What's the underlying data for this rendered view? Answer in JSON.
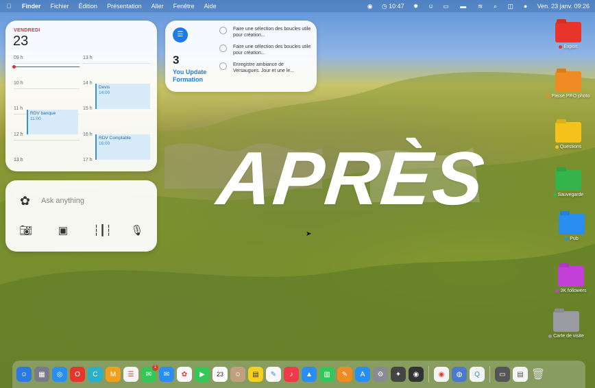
{
  "menubar": {
    "app_name": "Finder",
    "menus": [
      "Fichier",
      "Édition",
      "Présentation",
      "Aller",
      "Fenêtre",
      "Aide"
    ],
    "timer": "10:47",
    "datetime": "Ven. 23 janv. 09:26"
  },
  "calendar": {
    "day_name": "VENDREDI",
    "day_number": "23",
    "hours_left": [
      "09 h",
      "10 h",
      "11 h",
      "12 h",
      "13 h"
    ],
    "hours_right": [
      "13 h",
      "14 h",
      "15 h",
      "16 h",
      "17 h"
    ],
    "events": [
      {
        "title": "RDV banque",
        "time": "11:00"
      },
      {
        "title": "Devis",
        "time": "14:00"
      },
      {
        "title": "RDV Comptable",
        "time": "16:00"
      }
    ]
  },
  "reminders": {
    "count": "3",
    "list_name": "You Update Formation",
    "items": [
      "Faire une sélection des boucles utile pour création...",
      "Faire une sélection des boucles utile pour création...",
      "Enregistre ambiance de Versaugues. Jour et une le..."
    ]
  },
  "chatgpt": {
    "placeholder": "Ask anything",
    "tools": [
      "camera-icon",
      "photo-icon",
      "voice-waveform-icon",
      "microphone-icon"
    ]
  },
  "wallpaper_text": "APRÈS",
  "desktop_items": [
    {
      "label": "Export",
      "color": "#e8352b",
      "tag": "#e8352b"
    },
    {
      "label": "Passe PRO photo",
      "color": "#f08a24",
      "tag": "#f08a24"
    },
    {
      "label": "Questions",
      "color": "#f5c21b",
      "tag": "#f5c21b"
    },
    {
      "label": "Sauvegarde",
      "color": "#34b44a",
      "tag": "#34b44a"
    },
    {
      "label": "Pub",
      "color": "#2a8ef0",
      "tag": "#2a8ef0"
    },
    {
      "label": "3K followers",
      "color": "#c23fd8",
      "tag": "#c23fd8"
    },
    {
      "label": "Carte de visite",
      "color": "#9a9aa2",
      "tag": "#9a9aa2"
    }
  ],
  "dock": {
    "calendar_day": "23",
    "messages_badge": "1"
  }
}
